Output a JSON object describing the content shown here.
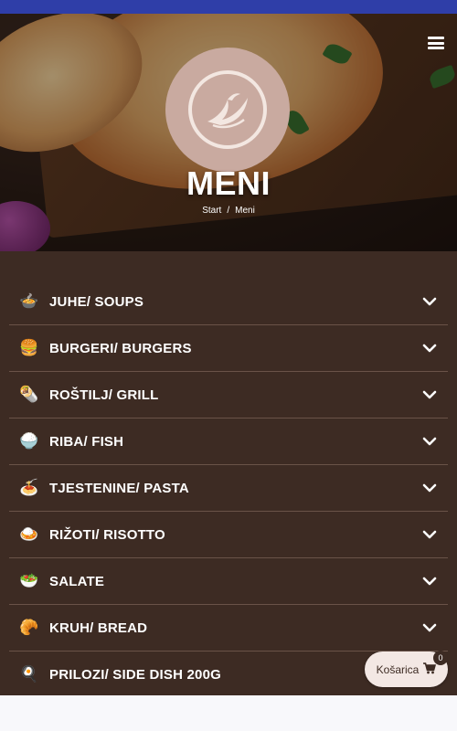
{
  "hero": {
    "title": "MENI",
    "breadcrumb": {
      "home": "Start",
      "separator": "/",
      "current": "Meni"
    },
    "logo_icon": "phoenix-bird-logo",
    "menu_icon": "hamburger-menu-icon"
  },
  "categories": [
    {
      "label": "JUHE/ SOUPS",
      "icon": "soup-bowl-icon",
      "glyph": "🍲"
    },
    {
      "label": "BURGERI/ BURGERS",
      "icon": "burger-icon",
      "glyph": "🍔"
    },
    {
      "label": "ROŠTILJ/ GRILL",
      "icon": "grill-icon",
      "glyph": "🌯"
    },
    {
      "label": "RIBA/ FISH",
      "icon": "fish-icon",
      "glyph": "🍚"
    },
    {
      "label": "TJESTENINE/ PASTA",
      "icon": "pasta-icon",
      "glyph": "🍝"
    },
    {
      "label": "RIŽOTI/ RISOTTO",
      "icon": "risotto-icon",
      "glyph": "🍛"
    },
    {
      "label": "SALATE",
      "icon": "salad-icon",
      "glyph": "🥗"
    },
    {
      "label": "KRUH/ BREAD",
      "icon": "bread-icon",
      "glyph": "🥐"
    },
    {
      "label": "PRILOZI/ SIDE DISH 200G",
      "icon": "side-dish-icon",
      "glyph": "🍳"
    }
  ],
  "cart": {
    "label": "Košarica",
    "count": "0",
    "icon": "cart-icon"
  },
  "colors": {
    "top_bar": "#2f3ea8",
    "menu_bg": "#3d2b23",
    "logo_bg": "#c9aaa0",
    "cart_bg": "#f3e8e4"
  }
}
